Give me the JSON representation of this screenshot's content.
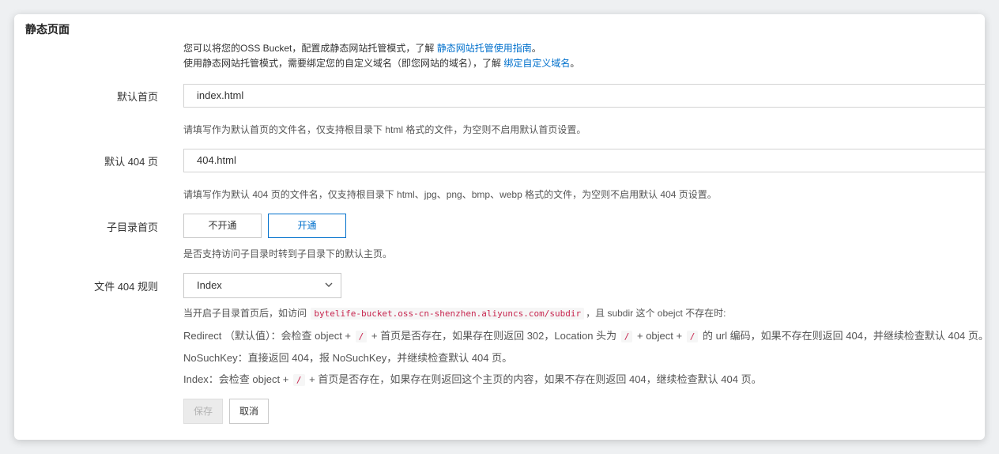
{
  "section": {
    "title": "静态页面"
  },
  "intro": {
    "line1_text": "您可以将您的OSS Bucket，配置成静态网站托管模式，了解 ",
    "line1_link": "静态网站托管使用指南",
    "line1_end": "。",
    "line2_text": "使用静态网站托管模式，需要绑定您的自定义域名（即您网站的域名），了解 ",
    "line2_link": "绑定自定义域名",
    "line2_end": "。"
  },
  "default_index": {
    "label": "默认首页",
    "value": "index.html",
    "help": "请填写作为默认首页的文件名，仅支持根目录下 html 格式的文件，为空则不启用默认首页设置。"
  },
  "default_404": {
    "label": "默认 404 页",
    "value": "404.html",
    "help": "请填写作为默认 404 页的文件名，仅支持根目录下 html、jpg、png、bmp、webp 格式的文件，为空则不启用默认 404 页设置。"
  },
  "subdir_index": {
    "label": "子目录首页",
    "options": [
      "不开通",
      "开通"
    ],
    "selected": "开通",
    "help": "是否支持访问子目录时转到子目录下的默认主页。"
  },
  "file_404_rule": {
    "label": "文件 404 规则",
    "selected": "Index",
    "intro_pre": "当开启子目录首页后，如访问 ",
    "intro_code": "bytelife-bucket.oss-cn-shenzhen.aliyuncs.com/subdir",
    "intro_post": "，且 subdir 这个 obejct 不存在时:",
    "redirect": {
      "p1": "Redirect （默认值）：会检查 object + ",
      "c1": "/",
      "p2": " + 首页是否存在，如果存在则返回 302，Location 头为 ",
      "c2": "/",
      "p3": " + object + ",
      "c3": "/",
      "p4": " 的 url 编码，如果不存在则返回 404，并继续检查默认 404 页。"
    },
    "nosuchkey": "NoSuchKey：直接返回 404，报 NoSuchKey，并继续检查默认 404 页。",
    "index": {
      "p1": "Index：会检查 object + ",
      "c1": "/",
      "p2": " + 首页是否存在，如果存在则返回这个主页的内容，如果不存在则返回 404，继续检查默认 404 页。"
    }
  },
  "actions": {
    "save": "保存",
    "cancel": "取消"
  },
  "colors": {
    "link": "#0070cc",
    "code": "#c7254e",
    "active_border": "#0070cc"
  },
  "icons": {
    "select_arrow": "chevron-down-icon"
  }
}
